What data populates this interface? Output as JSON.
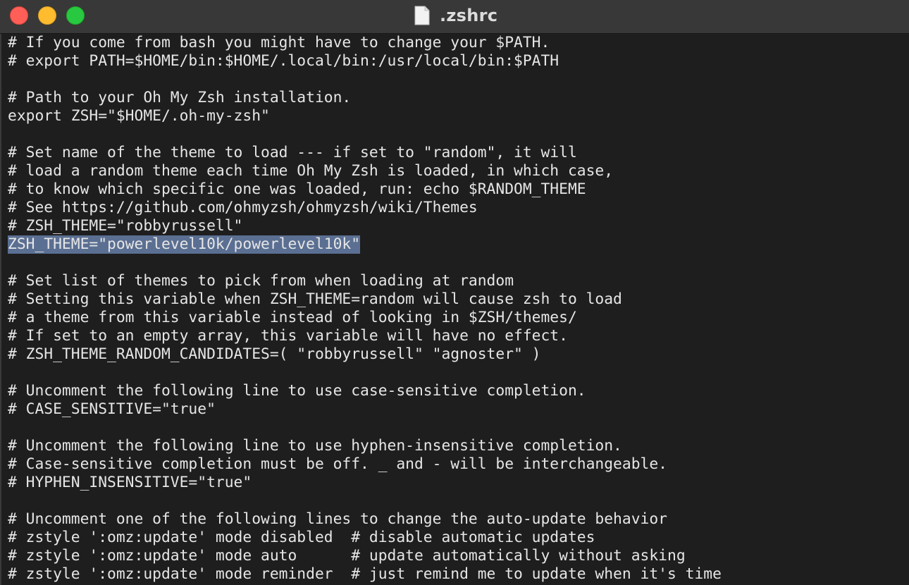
{
  "window": {
    "title": ".zshrc",
    "icon": "document-icon",
    "colors": {
      "close": "#ff5f57",
      "minimize": "#febc2e",
      "maximize": "#28c840",
      "selection": "#5a6f92",
      "background": "#1e1e1e",
      "text": "#e6e6e6"
    }
  },
  "editor": {
    "lines": [
      "# If you come from bash you might have to change your $PATH.",
      "# export PATH=$HOME/bin:$HOME/.local/bin:/usr/local/bin:$PATH",
      "",
      "# Path to your Oh My Zsh installation.",
      "export ZSH=\"$HOME/.oh-my-zsh\"",
      "",
      "# Set name of the theme to load --- if set to \"random\", it will",
      "# load a random theme each time Oh My Zsh is loaded, in which case,",
      "# to know which specific one was loaded, run: echo $RANDOM_THEME",
      "# See https://github.com/ohmyzsh/ohmyzsh/wiki/Themes",
      "# ZSH_THEME=\"robbyrussell\"",
      "ZSH_THEME=\"powerlevel10k/powerlevel10k\"",
      "",
      "# Set list of themes to pick from when loading at random",
      "# Setting this variable when ZSH_THEME=random will cause zsh to load",
      "# a theme from this variable instead of looking in $ZSH/themes/",
      "# If set to an empty array, this variable will have no effect.",
      "# ZSH_THEME_RANDOM_CANDIDATES=( \"robbyrussell\" \"agnoster\" )",
      "",
      "# Uncomment the following line to use case-sensitive completion.",
      "# CASE_SENSITIVE=\"true\"",
      "",
      "# Uncomment the following line to use hyphen-insensitive completion.",
      "# Case-sensitive completion must be off. _ and - will be interchangeable.",
      "# HYPHEN_INSENSITIVE=\"true\"",
      "",
      "# Uncomment one of the following lines to change the auto-update behavior",
      "# zstyle ':omz:update' mode disabled  # disable automatic updates",
      "# zstyle ':omz:update' mode auto      # update automatically without asking",
      "# zstyle ':omz:update' mode reminder  # just remind me to update when it's time"
    ],
    "selected_line": 11
  }
}
